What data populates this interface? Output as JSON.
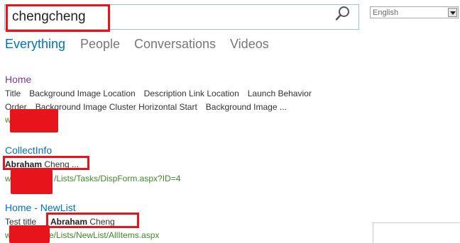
{
  "search": {
    "query": "chengcheng"
  },
  "language": {
    "selected": "English"
  },
  "tabs": [
    {
      "label": "Everything",
      "active": true
    },
    {
      "label": "People",
      "active": false
    },
    {
      "label": "Conversations",
      "active": false
    },
    {
      "label": "Videos",
      "active": false
    }
  ],
  "results": [
    {
      "title": "Home",
      "meta_line1": [
        "Title",
        "Background Image Location",
        "Description Link Location",
        "Launch Behavior"
      ],
      "meta_line2": [
        "Order",
        "Background Image Cluster Horizontal Start",
        "Background Image ..."
      ],
      "url": "w"
    },
    {
      "title": "CollectInfo",
      "author_bold": "Abraham",
      "author_rest": " Cheng ...",
      "url_prefix": "w",
      "url": "/Lists/Tasks/DispForm.aspx?ID=4"
    },
    {
      "title": "Home - NewList",
      "field_label": "Test title",
      "author_bold": "Abraham",
      "author_rest": " Cheng",
      "url_prefix": "w",
      "url": "e/Lists/NewList/AllItems.aspx"
    }
  ],
  "colors": {
    "accent": "#0072c6",
    "visited": "#7a3a8c",
    "url": "#3d8a28",
    "highlight": "#e8141c"
  }
}
